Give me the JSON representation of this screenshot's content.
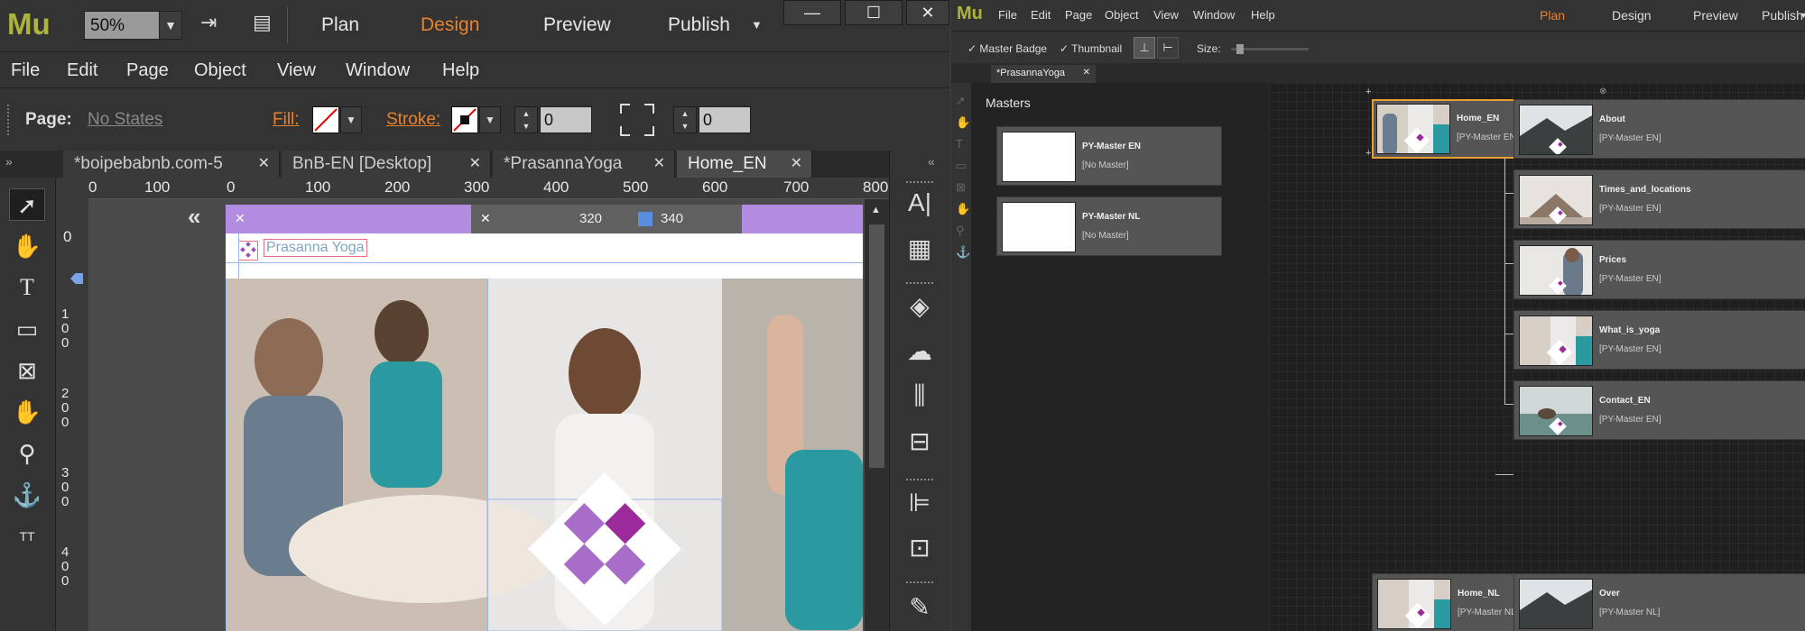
{
  "left_window": {
    "logo": "Mu",
    "zoom": "50%",
    "modes": [
      "Plan",
      "Design",
      "Preview",
      "Publish"
    ],
    "active_mode": "Design",
    "window_buttons": [
      "—",
      "☐",
      "✕"
    ],
    "menu": [
      "File",
      "Edit",
      "Page",
      "Object",
      "View",
      "Window",
      "Help"
    ],
    "controls": {
      "page_label": "Page:",
      "page_state": "No States",
      "fill_label": "Fill:",
      "stroke_label": "Stroke:",
      "stroke_value": "0",
      "corner_value": "0"
    },
    "tabs": [
      {
        "label": "*boipebabnb.com-5"
      },
      {
        "label": "BnB-EN [Desktop]"
      },
      {
        "label": "*PrasannaYoga"
      },
      {
        "label": "Home_EN"
      }
    ],
    "active_tab": "Home_EN",
    "ruler_top": [
      "0",
      "100",
      "0",
      "100",
      "200",
      "300",
      "400",
      "500",
      "600",
      "700",
      "800"
    ],
    "ruler_left": [
      "0",
      "1\n0\n0",
      "2\n0\n0",
      "3\n0\n0",
      "4\n0\n0"
    ],
    "breakpoints": {
      "left_value": "320",
      "right_value": "340"
    },
    "site_title": "Prasanna Yoga",
    "accent_colors": {
      "design": "#e8822e",
      "breakpoint": "#b18ce0",
      "logo_purple": "#9b4db4"
    }
  },
  "right_window": {
    "logo": "Mu",
    "menu": [
      "File",
      "Edit",
      "Page",
      "Object",
      "View",
      "Window",
      "Help"
    ],
    "modes": [
      "Plan",
      "Design",
      "Preview",
      "Publish"
    ],
    "active_mode": "Plan",
    "toolbar": {
      "master_badge": "Master Badge",
      "thumbnail": "Thumbnail",
      "size_label": "Size:"
    },
    "tab": "*PrasannaYoga",
    "masters_heading": "Masters",
    "masters": [
      {
        "name": "PY-Master EN",
        "master": "[No Master]"
      },
      {
        "name": "PY-Master NL",
        "master": "[No Master]"
      }
    ],
    "pages": [
      {
        "name": "Home_EN",
        "master": "[PY-Master EN]",
        "selected": true
      },
      {
        "name": "About",
        "master": "[PY-Master EN]"
      },
      {
        "name": "Times_and_locations",
        "master": "[PY-Master EN]"
      },
      {
        "name": "Prices",
        "master": "[PY-Master EN]"
      },
      {
        "name": "What_is_yoga",
        "master": "[PY-Master EN]"
      },
      {
        "name": "Contact_EN",
        "master": "[PY-Master EN]"
      },
      {
        "name": "Home_NL",
        "master": "[PY-Master NL]"
      },
      {
        "name": "Over",
        "master": "[PY-Master NL]"
      }
    ]
  }
}
